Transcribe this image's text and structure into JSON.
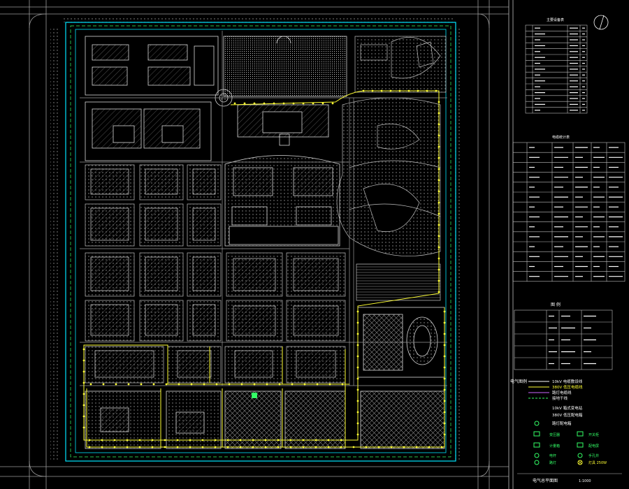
{
  "drawing": {
    "colors": {
      "background": "#000000",
      "boundary": "#00e5ff",
      "boundary_dash": "#33ff66",
      "road": "#9a9a9a",
      "building": "#d8d8d8",
      "cable_10kv": "#ffffff",
      "cable_380v": "#ffff33",
      "lamp": "#ffff33",
      "street_lamp_line": "#cc66ff",
      "ground": "#33ff66"
    }
  },
  "legend": {
    "title": "电气图例",
    "items": [
      {
        "symbol": "cable-10kv-icon",
        "label": "10kV 电缆敷设线"
      },
      {
        "symbol": "cable-380v-icon",
        "label": "380V 低压电缆线"
      },
      {
        "symbol": "street-lamp-cable-icon",
        "label": "路灯电缆线"
      },
      {
        "symbol": "ground-line-icon",
        "label": "接地干线"
      },
      {
        "symbol": "substation-10kv-icon",
        "label": "10kV 箱式变电站"
      },
      {
        "symbol": "dist-box-380v-icon",
        "label": "380V 低压配电箱"
      },
      {
        "symbol": "lamp-box-icon",
        "label": "路灯配电箱"
      }
    ],
    "symbols": [
      {
        "icon": "transformer-icon",
        "label": "变压器"
      },
      {
        "icon": "switch-icon",
        "label": "开关柜"
      },
      {
        "icon": "meter-icon",
        "label": "计量箱"
      },
      {
        "icon": "panel-icon",
        "label": "配电屏"
      },
      {
        "icon": "pole-icon",
        "label": "电杆"
      },
      {
        "icon": "handhole-icon",
        "label": "手孔井"
      },
      {
        "icon": "lamp-icon",
        "label": "路灯"
      },
      {
        "icon": "light-icon",
        "label": "灯具 250W"
      }
    ]
  },
  "title_block": {
    "caption": "电气总平面图",
    "scale": "1:1000"
  },
  "tables": {
    "table1_title": "主要设备表",
    "table2_title": "电缆统计表",
    "table3_title": "图 例",
    "row_count_t1": 15,
    "row_count_t2": 14,
    "row_count_t3": 5
  }
}
